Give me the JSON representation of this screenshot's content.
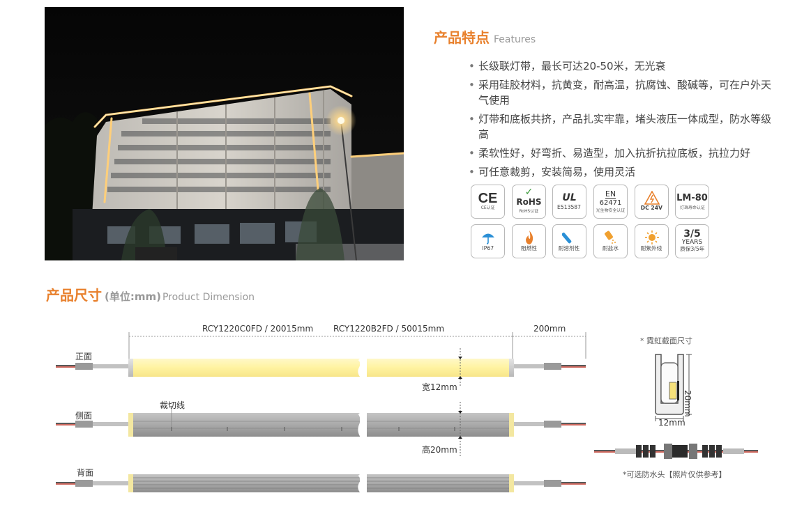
{
  "features": {
    "title": "产品特点",
    "title_en": "Features",
    "items": [
      "长级联灯带，最长可达20-50米，无光衰",
      "采用硅胶材料，抗黄变，耐高温，抗腐蚀、酸碱等，可在户外天气使用",
      "灯带和底板共挤，产品扎实牢靠，堵头液压一体成型，防水等级高",
      "柔软性好，好弯折、易造型，加入抗折抗拉底板，抗拉力好",
      "可任意裁剪，安装简易，使用灵活"
    ]
  },
  "certs": {
    "ce": {
      "main": "CE",
      "cap": "CE认证"
    },
    "rohs": {
      "main": "RoHS",
      "cap": "RoHS认证"
    },
    "ul": {
      "main": "UL",
      "cap": "E513587"
    },
    "en": {
      "line1": "EN",
      "line2": "62471",
      "cap": "光生物安全认证"
    },
    "dc": {
      "cap": "DC 24V"
    },
    "lm": {
      "main": "LM-80",
      "cap": "灯珠寿命认证"
    },
    "ip": {
      "cap": "IP67"
    },
    "fire": {
      "cap": "阻燃性"
    },
    "solvent": {
      "cap": "耐溶剂性"
    },
    "salt": {
      "cap": "耐盐水"
    },
    "uv": {
      "cap": "耐紫外线"
    },
    "warranty": {
      "main": "3/5",
      "sub": "YEARS",
      "cap": "质保3/5年"
    }
  },
  "dimension": {
    "title": "产品尺寸",
    "unit": "(单位:mm)",
    "title_en": "Product Dimension",
    "model1": "RCY1220C0FD / 20015mm",
    "model2": "RCY1220B2FD / 50015mm",
    "lead_length": "200mm",
    "view_front": "正面",
    "view_side": "侧面",
    "view_back": "背面",
    "cut_line": "裁切线",
    "width_label": "宽12mm",
    "height_label": "高20mm",
    "section_title": "* 霓虹截面尺寸",
    "section_h": "20mm",
    "section_w": "12mm",
    "connector_note": "*可选防水头【照片仅供参考】"
  },
  "colors": {
    "accent": "#e8802c",
    "led_yellow": "#fff3a8",
    "grey_profile": "#a9a9a9"
  }
}
